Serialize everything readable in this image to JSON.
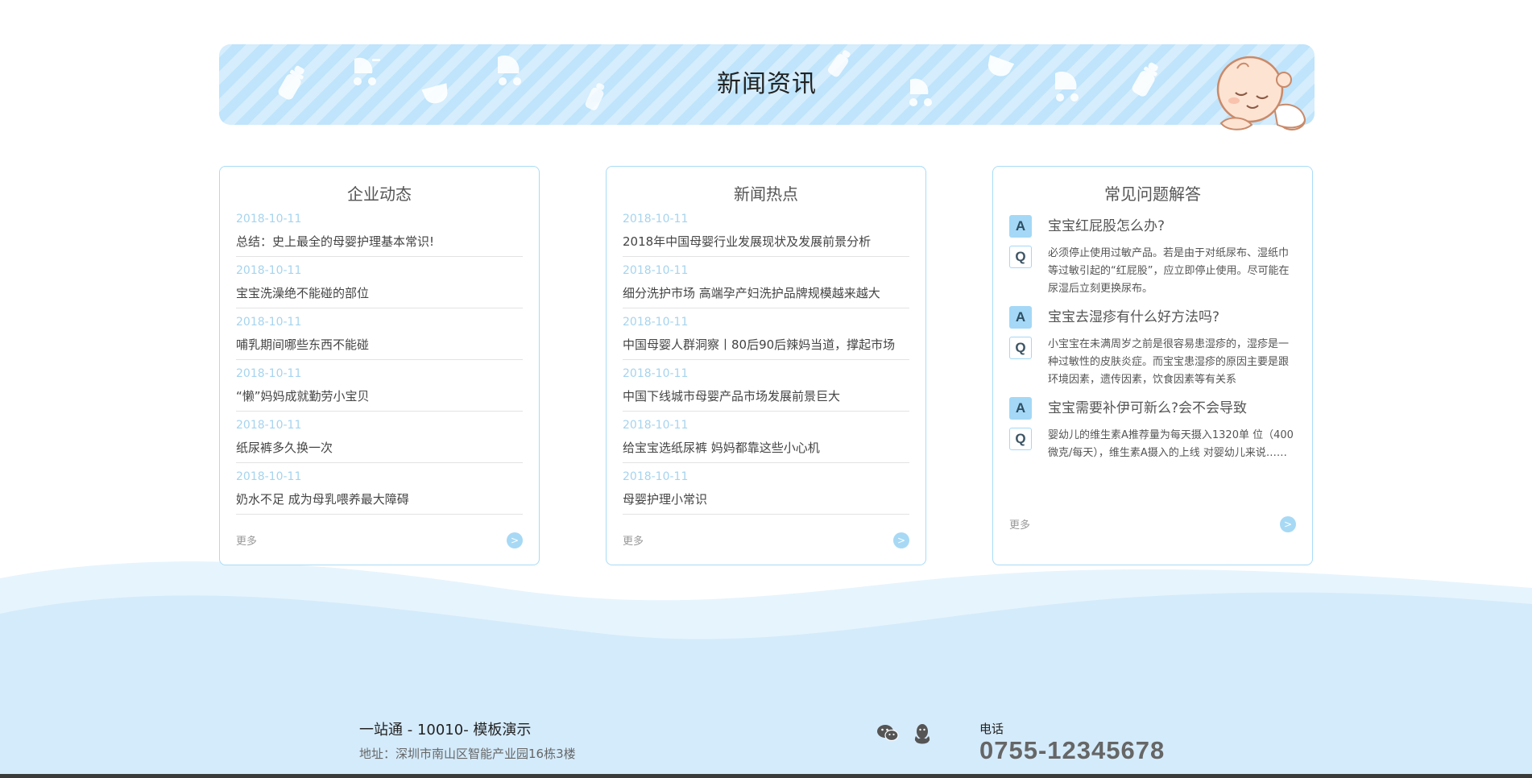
{
  "banner": {
    "title": "新闻资讯"
  },
  "company_news": {
    "title": "企业动态",
    "items": [
      {
        "date": "2018-10-11",
        "title": "总结：史上最全的母婴护理基本常识!"
      },
      {
        "date": "2018-10-11",
        "title": "宝宝洗澡绝不能碰的部位"
      },
      {
        "date": "2018-10-11",
        "title": "哺乳期间哪些东西不能碰"
      },
      {
        "date": "2018-10-11",
        "title": "“懒”妈妈成就勤劳小宝贝"
      },
      {
        "date": "2018-10-11",
        "title": "纸尿裤多久换一次"
      },
      {
        "date": "2018-10-11",
        "title": "奶水不足 成为母乳喂养最大障碍"
      }
    ],
    "more_label": "更多",
    "more_arrow": ">"
  },
  "hot_news": {
    "title": "新闻热点",
    "items": [
      {
        "date": "2018-10-11",
        "title": "2018年中国母婴行业发展现状及发展前景分析"
      },
      {
        "date": "2018-10-11",
        "title": "细分洗护市场 高端孕产妇洗护品牌规模越来越大"
      },
      {
        "date": "2018-10-11",
        "title": "中国母婴人群洞察丨80后90后辣妈当道，撑起市场"
      },
      {
        "date": "2018-10-11",
        "title": "中国下线城市母婴产品市场发展前景巨大"
      },
      {
        "date": "2018-10-11",
        "title": "给宝宝选纸尿裤 妈妈都靠这些小心机"
      },
      {
        "date": "2018-10-11",
        "title": "母婴护理小常识"
      }
    ],
    "more_label": "更多",
    "more_arrow": ">"
  },
  "faq": {
    "title": "常见问题解答",
    "badge_a": "A",
    "badge_q": "Q",
    "items": [
      {
        "question": "宝宝红屁股怎么办?",
        "answer": "必须停止使用过敏产品。若是由于对纸尿布、湿纸巾等过敏引起的“红屁股”，应立即停止使用。尽可能在尿湿后立刻更换尿布。"
      },
      {
        "question": "宝宝去湿疹有什么好方法吗?",
        "answer": "小宝宝在未满周岁之前是很容易患湿疹的，湿疹是一种过敏性的皮肤炎症。而宝宝患湿疹的原因主要是跟环境因素，遗传因素，饮食因素等有关系"
      },
      {
        "question": "宝宝需要补伊可新么?会不会导致",
        "answer": "婴幼儿的维生素A推荐量为每天摄入1320单 位（400微克/每天），维生素A摄入的上线 对婴幼儿来说……"
      }
    ],
    "more_label": "更多",
    "more_arrow": ">"
  },
  "footer": {
    "company": "一站通 - 10010- 模板演示",
    "address": "地址：深圳市南山区智能产业园16栋3楼",
    "phone_label": "电话",
    "phone_number": "0755-12345678"
  },
  "colors": {
    "accent": "#a7d9f5",
    "banner_bg": "#bfe4fb",
    "wave": "#d6ecfb"
  },
  "icons": [
    "wechat-icon",
    "qq-icon",
    "baby-bottle-icon",
    "stroller-icon",
    "diaper-icon",
    "sleeping-baby-icon"
  ]
}
